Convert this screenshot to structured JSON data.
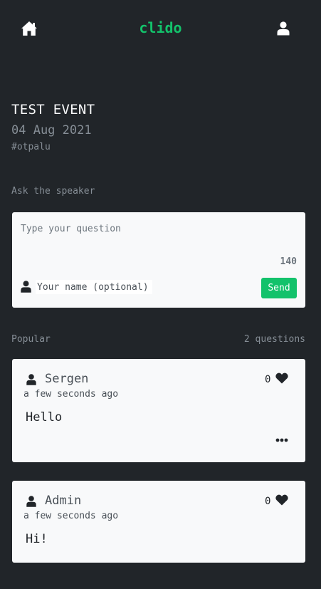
{
  "header": {
    "logo": "clido",
    "home_icon": "home-icon",
    "user_icon": "user-icon",
    "accent_color": "#13c26b"
  },
  "event": {
    "title": "TEST EVENT",
    "date": "04 Aug 2021",
    "code": "#otpalu"
  },
  "ask": {
    "label": "Ask the speaker",
    "question_placeholder": "Type your question",
    "question_value": "",
    "char_count": "140",
    "name_placeholder": "Your name (optional)",
    "name_value": "",
    "send_label": "Send"
  },
  "popular": {
    "label": "Popular",
    "count_text": "2 questions"
  },
  "questions": [
    {
      "author": "Sergen",
      "time": "a few seconds ago",
      "likes": "0",
      "text": "Hello",
      "has_menu": true
    },
    {
      "author": "Admin",
      "time": "a few seconds ago",
      "likes": "0",
      "text": "Hi!",
      "has_menu": false
    }
  ]
}
